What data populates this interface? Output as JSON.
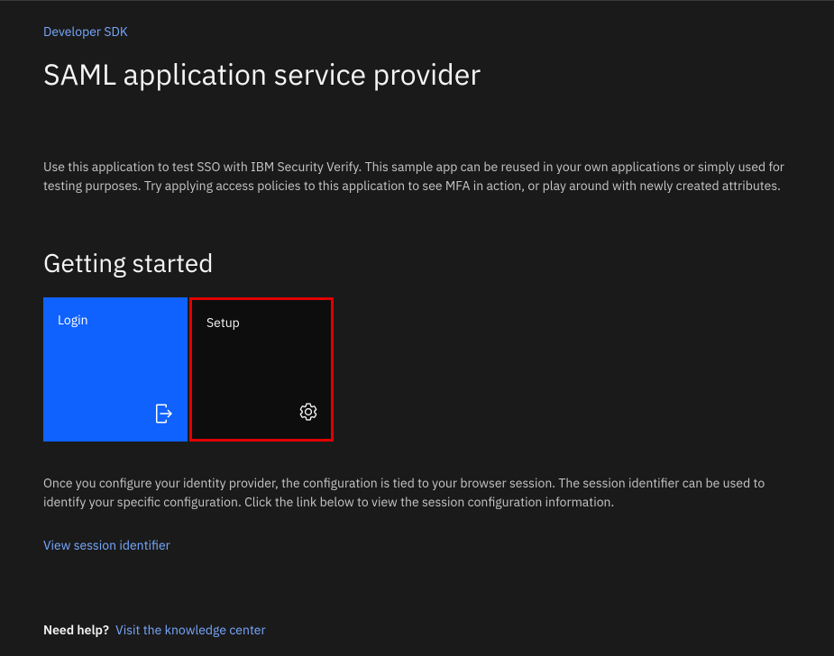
{
  "breadcrumb": "Developer SDK",
  "title": "SAML application service provider",
  "intro": "Use this application to test SSO with IBM Security Verify. This sample app can be reused in your own applications or simply used for testing purposes. Try applying access policies to this application to see MFA in action, or play around with newly created attributes.",
  "getting_started": {
    "heading": "Getting started",
    "tiles": [
      {
        "label": "Login"
      },
      {
        "label": "Setup"
      }
    ]
  },
  "config_text": "Once you configure your identity provider, the configuration is tied to your browser session. The session identifier can be used to identify your specific configuration. Click the link below to view the session configuration information.",
  "session_link": "View session identifier",
  "footer": {
    "label": "Need help?",
    "link": "Visit the knowledge center"
  }
}
